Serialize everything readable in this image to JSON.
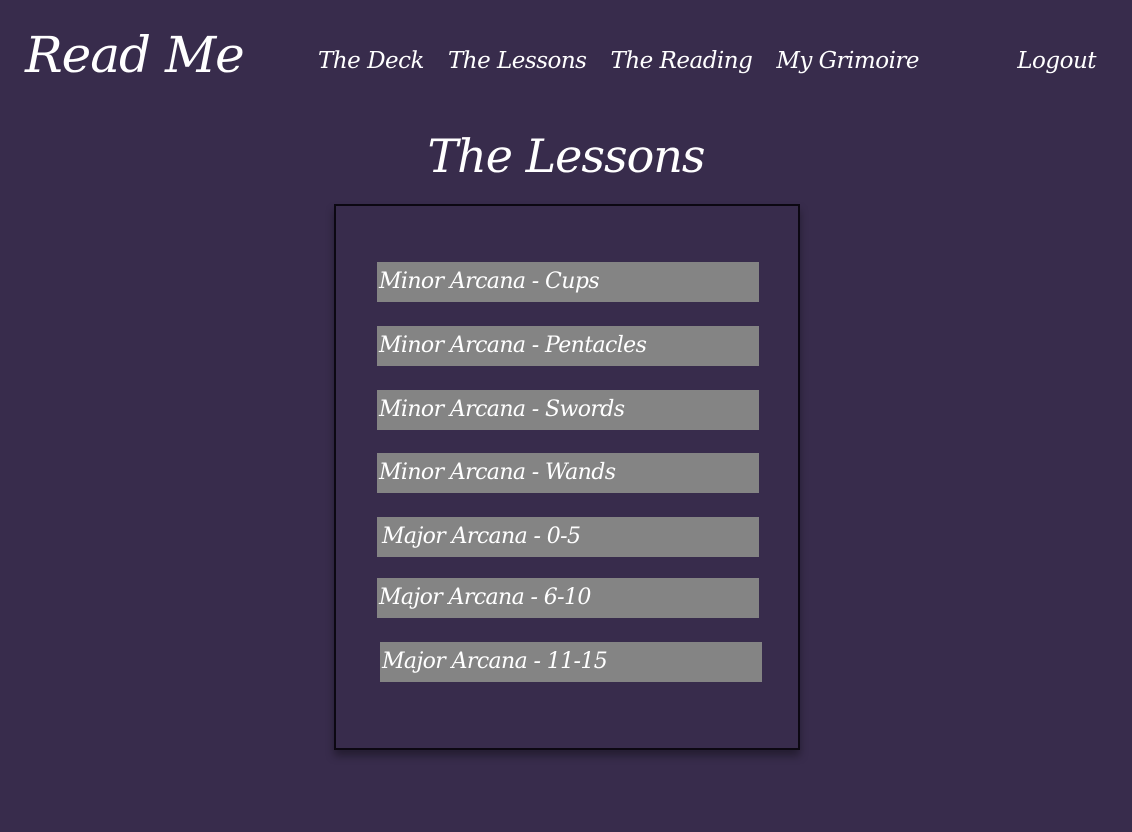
{
  "header": {
    "brand": "Read Me",
    "nav": [
      "The Deck",
      "The Lessons",
      "The Reading",
      "My Grimoire"
    ],
    "logout": "Logout"
  },
  "main": {
    "title": "The Lessons",
    "lessons": [
      "Minor Arcana - Cups",
      "Minor Arcana - Pentacles",
      "Minor Arcana - Swords",
      "Minor Arcana - Wands",
      "Major Arcana - 0-5",
      "Major Arcana - 6-10",
      "Major Arcana - 11-15"
    ]
  },
  "colors": {
    "background": "#382c4c",
    "lesson_button": "#848484",
    "text": "#ffffff"
  }
}
